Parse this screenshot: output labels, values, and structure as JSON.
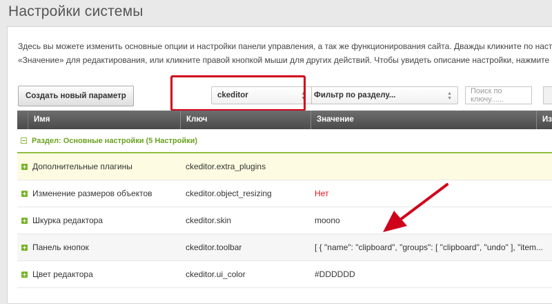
{
  "page": {
    "title": "Настройки системы"
  },
  "description": {
    "line1": "Здесь вы можете изменить основные опции и настройки панели управления, а так же функционирования сайта. Дважды кликните по настройке",
    "line2": "«Значение» для редактирования, или кликните правой кнопкой мыши для других действий. Чтобы увидеть описание настройки, нажмите на «+»"
  },
  "toolbar": {
    "create_label": "Создать новый параметр",
    "namespace_value": "ckeditor",
    "section_filter_value": "Фильтр по разделу...",
    "search_placeholder": "Поиск по ключу......"
  },
  "table": {
    "headers": {
      "name": "Имя",
      "key": "Ключ",
      "value": "Значение",
      "extra": "Из"
    },
    "section_label": "Раздел: Основные настройки (5 Настройки)",
    "rows": [
      {
        "name": "Дополнительные плагины",
        "key": "ckeditor.extra_plugins",
        "value": ""
      },
      {
        "name": "Изменение размеров объектов",
        "key": "ckeditor.object_resizing",
        "value": "Нет"
      },
      {
        "name": "Шкурка редактора",
        "key": "ckeditor.skin",
        "value": "moono"
      },
      {
        "name": "Панель кнопок",
        "key": "ckeditor.toolbar",
        "value": "[ { \"name\": \"clipboard\", \"groups\": [ \"clipboard\", \"undo\" ], \"item..."
      },
      {
        "name": "Цвет редактора",
        "key": "ckeditor.ui_color",
        "value": "#DDDDDD"
      }
    ]
  },
  "colors": {
    "highlight": "#d0021b",
    "section_green": "#6aa020",
    "value_red": "#e0141e",
    "header_dark": "#555555"
  }
}
